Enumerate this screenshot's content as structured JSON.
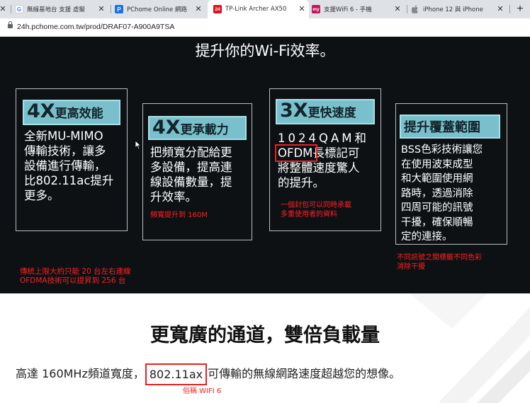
{
  "tabs": [
    {
      "title": "無線基地台 支援 虛擬",
      "favicon_text": "G",
      "favicon_color": "#4285f4",
      "active": false
    },
    {
      "title": "PChome Online 網路",
      "favicon_text": "P",
      "favicon_color": "#1a73e8",
      "active": false
    },
    {
      "title": "TP-Link Archer AX50",
      "favicon_text": "24",
      "favicon_color": "#e0101e",
      "active": true
    },
    {
      "title": "支援WiFi 6 - 手機",
      "favicon_text": "my",
      "favicon_color": "#c2185b",
      "active": false
    },
    {
      "title": "iPhone 12 與 iPhone",
      "favicon_text": "",
      "favicon_color": "#888888",
      "active": false
    }
  ],
  "address_bar": {
    "url": "24h.pchome.com.tw/prod/DRAF07-A900A9TSA"
  },
  "hero": {
    "title": "提升你的Wi-Fi效率。",
    "cards": [
      {
        "badge_big": "4X",
        "badge_small": "更高效能",
        "lines": [
          "全新MU-MIMO",
          "傳輸技術，讓多",
          "設備進行傳輸，",
          "比802.11ac提升",
          "更多。"
        ]
      },
      {
        "badge_big": "4X",
        "badge_small": "更承載力",
        "lines": [
          "把頻寬分配給更",
          "多設備，提高連",
          "線設備數量，提",
          "升效率。"
        ]
      },
      {
        "badge_big": "3X",
        "badge_small": "更快速度",
        "lines": [
          "1024QAM和",
          "OFDM長標記可",
          "將整體速度驚人",
          "的提升。"
        ]
      },
      {
        "badge_big": "",
        "badge_small": "提升覆蓋範圍",
        "lines": [
          "BSS色彩技術讓您",
          "在使用波束成型",
          "和大範圍使用網",
          "路時，透過消除",
          "四周可能的訊號",
          "干擾，確保順暢",
          "定的連接。"
        ]
      }
    ]
  },
  "annotations": {
    "card2_note": "頻寬提升到 160M",
    "card3_note_1": "一個封包可以同時承載",
    "card3_note_2": "多重使用者的資料",
    "card4_note_1": "不同訊號之間標籤不同色彩",
    "card4_note_2": "消除干擾",
    "left_note_1": "傳統上限大約只能 20 台左右連線",
    "left_note_2": "OFDMA技術可以提昇到 256 台",
    "wifi6_note": "俗稱 WIFI 6"
  },
  "section2": {
    "title": "更寬廣的通道，雙倍負載量",
    "line_prefix": "高達 160MHz頻道寬度，",
    "line_highlight": "802.11ax",
    "line_suffix": "可傳輸的無線網路速度超越您的想像。"
  },
  "colors": {
    "annotation_red": "#e6211f",
    "badge_teal": "#7ac0cc",
    "hero_bg": "#0e1114"
  }
}
